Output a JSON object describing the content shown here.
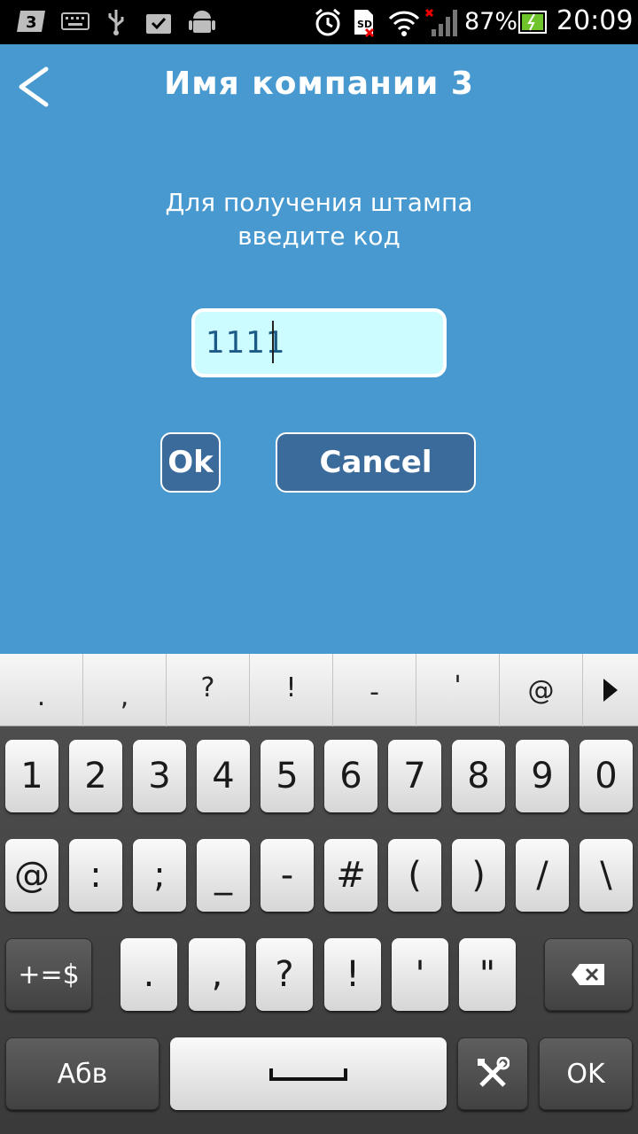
{
  "status_bar": {
    "battery_percent": "87%",
    "time": "20:09",
    "icons": [
      "carrier-3-icon",
      "keyboard-icon",
      "usb-icon",
      "task-icon",
      "android-icon",
      "alarm-icon",
      "sim-icon",
      "wifi-icon",
      "signal-icon",
      "battery-icon"
    ]
  },
  "header": {
    "title": "Имя компании 3",
    "back_icon": "back-chevron-icon"
  },
  "prompt": {
    "line1": "Для получения штампа",
    "line2": "введите код"
  },
  "code_input": {
    "value": "1111"
  },
  "buttons": {
    "ok_label": "Ok",
    "cancel_label": "Cancel"
  },
  "keyboard": {
    "suggestions": [
      ".",
      ",",
      "?",
      "!",
      "-",
      "'",
      "@"
    ],
    "row1": [
      "1",
      "2",
      "3",
      "4",
      "5",
      "6",
      "7",
      "8",
      "9",
      "0"
    ],
    "row2": [
      "@",
      ":",
      ";",
      "_",
      "-",
      "#",
      "(",
      ")",
      "/",
      "\\"
    ],
    "row3": [
      ".",
      ",",
      "?",
      "!",
      "'",
      "\""
    ],
    "symbols_label": "+=$",
    "abc_label": "Абв",
    "ok_label": "OK",
    "colors": {
      "key_light": "#f0f0f0",
      "key_dark": "#4a4a4a",
      "app_bg": "#4799cf",
      "input_bg": "#ccfcff"
    }
  }
}
